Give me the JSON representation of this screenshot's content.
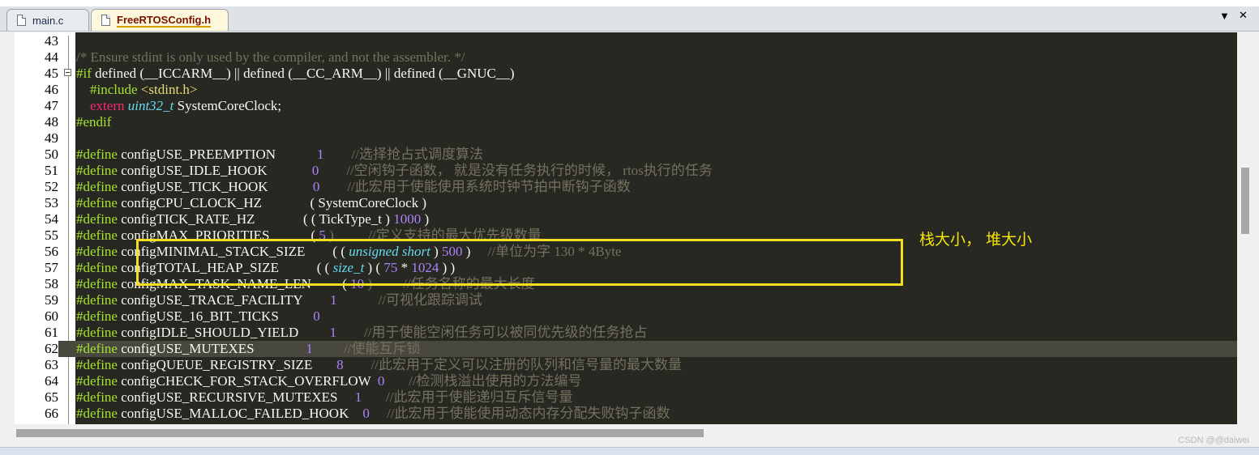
{
  "tabs": [
    {
      "label": "main.c"
    },
    {
      "label": "FreeRTOSConfig.h"
    }
  ],
  "tab_controls": {
    "dropdown": "▼",
    "close": "✕"
  },
  "annotation": "栈大小， 堆大小",
  "watermark": "CSDN @@daiwei",
  "highlighted_line": 62,
  "colors": {
    "editor_bg": "#272822",
    "comment": "#75715e",
    "preprocessor": "#a6e22e",
    "highlight_box": "#f0e020"
  },
  "lines": [
    {
      "n": "43",
      "segs": []
    },
    {
      "n": "44",
      "segs": [
        {
          "t": "/* Ensure stdint is only used by the compiler, and not the assembler. */",
          "c": "comment"
        }
      ]
    },
    {
      "n": "45",
      "segs": [
        {
          "t": "#if",
          "c": "pp"
        },
        {
          "t": " defined (__ICCARM__) || defined (__CC_ARM__) || defined (__GNUC__)",
          "c": ""
        }
      ]
    },
    {
      "n": "46",
      "segs": [
        {
          "t": "    #include ",
          "c": "pp"
        },
        {
          "t": "<stdint.h>",
          "c": "str"
        }
      ]
    },
    {
      "n": "47",
      "segs": [
        {
          "t": "    extern ",
          "c": "kw"
        },
        {
          "t": "uint32_t",
          "c": "typ"
        },
        {
          "t": " SystemCoreClock;",
          "c": ""
        }
      ]
    },
    {
      "n": "48",
      "segs": [
        {
          "t": "#endif",
          "c": "pp"
        }
      ]
    },
    {
      "n": "49",
      "segs": []
    },
    {
      "n": "50",
      "segs": [
        {
          "t": "#define",
          "c": "pp"
        },
        {
          "t": " configUSE_PREEMPTION            ",
          "c": ""
        },
        {
          "t": "1",
          "c": "num"
        },
        {
          "t": "        //选择抢占式调度算法",
          "c": "comment"
        }
      ]
    },
    {
      "n": "51",
      "segs": [
        {
          "t": "#define",
          "c": "pp"
        },
        {
          "t": " configUSE_IDLE_HOOK             ",
          "c": ""
        },
        {
          "t": "0",
          "c": "num"
        },
        {
          "t": "        //空闲钩子函数， 就是没有任务执行的时候， rtos执行的任务",
          "c": "comment"
        }
      ]
    },
    {
      "n": "52",
      "segs": [
        {
          "t": "#define",
          "c": "pp"
        },
        {
          "t": " configUSE_TICK_HOOK             ",
          "c": ""
        },
        {
          "t": "0",
          "c": "num"
        },
        {
          "t": "        //此宏用于使能使用系统时钟节拍中断钩子函数",
          "c": "comment"
        }
      ]
    },
    {
      "n": "53",
      "segs": [
        {
          "t": "#define",
          "c": "pp"
        },
        {
          "t": " configCPU_CLOCK_HZ              ( SystemCoreClock )",
          "c": ""
        }
      ]
    },
    {
      "n": "54",
      "segs": [
        {
          "t": "#define",
          "c": "pp"
        },
        {
          "t": " configTICK_RATE_HZ              ( ( TickType_t ) ",
          "c": ""
        },
        {
          "t": "1000",
          "c": "num"
        },
        {
          "t": " )",
          "c": ""
        }
      ]
    },
    {
      "n": "55",
      "segs": [
        {
          "t": "#define",
          "c": "pp"
        },
        {
          "t": " configMAX_PRIORITIES            ( ",
          "c": ""
        },
        {
          "t": "5",
          "c": "num"
        },
        {
          "t": " )          //定义支持的最大优先级数量",
          "c": "comment"
        }
      ]
    },
    {
      "n": "56",
      "segs": [
        {
          "t": "#define",
          "c": "pp"
        },
        {
          "t": " configMINIMAL_STACK_SIZE        ( ( ",
          "c": ""
        },
        {
          "t": "unsigned short",
          "c": "typ"
        },
        {
          "t": " ) ",
          "c": ""
        },
        {
          "t": "500",
          "c": "num"
        },
        {
          "t": " )     ",
          "c": ""
        },
        {
          "t": "//单位为字 130 * 4Byte",
          "c": "comment"
        }
      ]
    },
    {
      "n": "57",
      "segs": [
        {
          "t": "#define",
          "c": "pp"
        },
        {
          "t": " configTOTAL_HEAP_SIZE           ( ( ",
          "c": ""
        },
        {
          "t": "size_t",
          "c": "typ"
        },
        {
          "t": " ) ( ",
          "c": ""
        },
        {
          "t": "75",
          "c": "num"
        },
        {
          "t": " * ",
          "c": ""
        },
        {
          "t": "1024",
          "c": "num"
        },
        {
          "t": " ) )",
          "c": ""
        }
      ]
    },
    {
      "n": "58",
      "segs": [
        {
          "t": "#define",
          "c": "pp"
        },
        {
          "t": " configMAX_TASK_NAME_LEN         ( ",
          "c": ""
        },
        {
          "t": "10",
          "c": "num"
        },
        {
          "t": " )         //任务名称的最大长度",
          "c": "comment"
        }
      ]
    },
    {
      "n": "59",
      "segs": [
        {
          "t": "#define",
          "c": "pp"
        },
        {
          "t": " configUSE_TRACE_FACILITY        ",
          "c": ""
        },
        {
          "t": "1",
          "c": "num"
        },
        {
          "t": "            //可视化跟踪调试",
          "c": "comment"
        }
      ]
    },
    {
      "n": "60",
      "segs": [
        {
          "t": "#define",
          "c": "pp"
        },
        {
          "t": " configUSE_16_BIT_TICKS          ",
          "c": ""
        },
        {
          "t": "0",
          "c": "num"
        }
      ]
    },
    {
      "n": "61",
      "segs": [
        {
          "t": "#define",
          "c": "pp"
        },
        {
          "t": " configIDLE_SHOULD_YIELD         ",
          "c": ""
        },
        {
          "t": "1",
          "c": "num"
        },
        {
          "t": "        //用于使能空闲任务可以被同优先级的任务抢占",
          "c": "comment"
        }
      ]
    },
    {
      "n": "62",
      "segs": [
        {
          "t": "#define",
          "c": "pp"
        },
        {
          "t": " configUSE_MUTEXES               ",
          "c": ""
        },
        {
          "t": "1",
          "c": "num"
        },
        {
          "t": "         //使能互斥锁",
          "c": "comment"
        }
      ]
    },
    {
      "n": "63",
      "segs": [
        {
          "t": "#define",
          "c": "pp"
        },
        {
          "t": " configQUEUE_REGISTRY_SIZE       ",
          "c": ""
        },
        {
          "t": "8",
          "c": "num"
        },
        {
          "t": "        //此宏用于定义可以注册的队列和信号量的最大数量",
          "c": "comment"
        }
      ]
    },
    {
      "n": "64",
      "segs": [
        {
          "t": "#define",
          "c": "pp"
        },
        {
          "t": " configCHECK_FOR_STACK_OVERFLOW  ",
          "c": ""
        },
        {
          "t": "0",
          "c": "num"
        },
        {
          "t": "       //检测栈溢出使用的方法编号",
          "c": "comment"
        }
      ]
    },
    {
      "n": "65",
      "segs": [
        {
          "t": "#define",
          "c": "pp"
        },
        {
          "t": " configUSE_RECURSIVE_MUTEXES     ",
          "c": ""
        },
        {
          "t": "1",
          "c": "num"
        },
        {
          "t": "       //此宏用于使能递归互斥信号量",
          "c": "comment"
        }
      ]
    },
    {
      "n": "66",
      "segs": [
        {
          "t": "#define",
          "c": "pp"
        },
        {
          "t": " configUSE_MALLOC_FAILED_HOOK    ",
          "c": ""
        },
        {
          "t": "0",
          "c": "num"
        },
        {
          "t": "     //此宏用于使能使用动态内存分配失败钩子函数",
          "c": "comment"
        }
      ]
    }
  ]
}
